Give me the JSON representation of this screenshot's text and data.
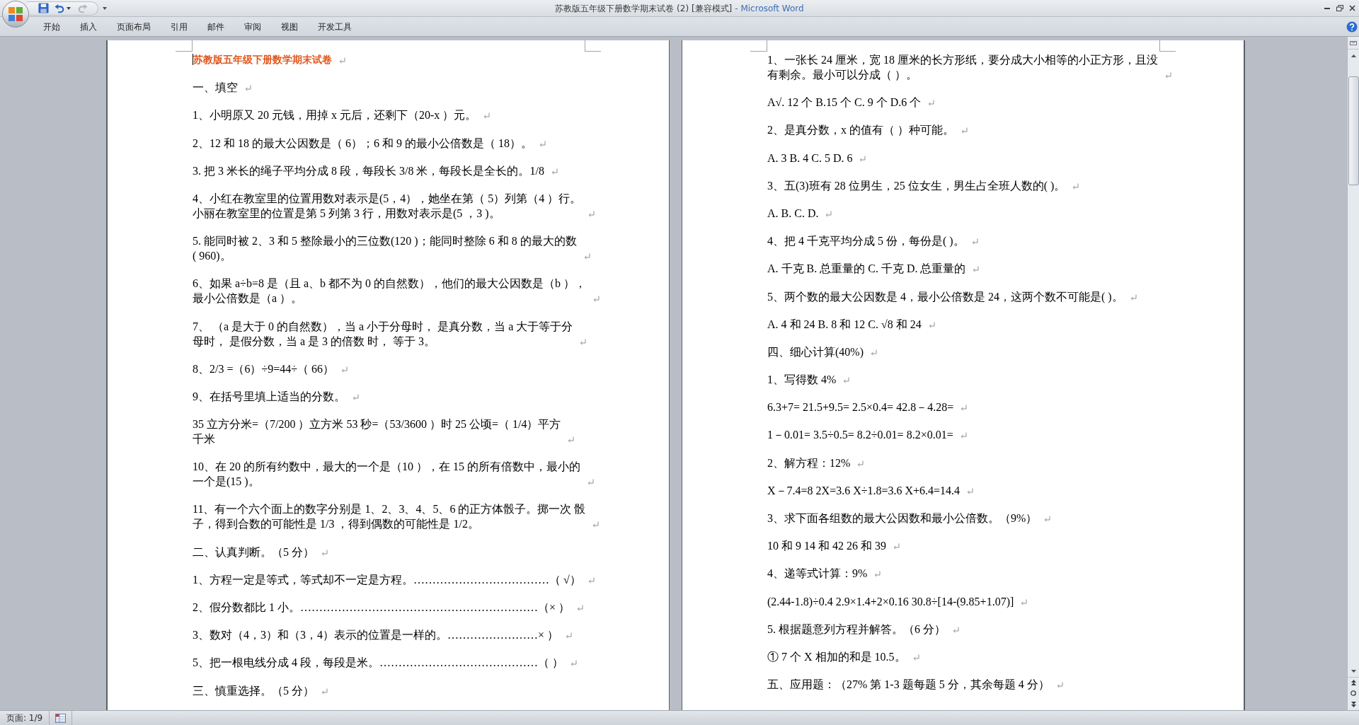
{
  "title_bar": {
    "document": "苏教版五年级下册数学期末试卷 (2) [兼容模式]",
    "app": "- Microsoft Word"
  },
  "quick_access": [
    {
      "kind": "save",
      "disabled": false
    },
    {
      "kind": "undo",
      "disabled": false
    },
    {
      "kind": "redo",
      "disabled": true
    }
  ],
  "ribbon_tabs": [
    {
      "label": "开始",
      "selected": false
    },
    {
      "label": "插入",
      "selected": false
    },
    {
      "label": "页面布局",
      "selected": false
    },
    {
      "label": "引用",
      "selected": false
    },
    {
      "label": "邮件",
      "selected": false
    },
    {
      "label": "审阅",
      "selected": false
    },
    {
      "label": "视图",
      "selected": false
    },
    {
      "label": "开发工具",
      "selected": false
    }
  ],
  "pages": [
    {
      "caret_at_start": true,
      "paragraphs": [
        {
          "kind": "title",
          "lines": [
            "苏教版五年级下册数学期末试卷"
          ]
        },
        {
          "kind": "text",
          "lines": [
            "一、填空"
          ]
        },
        {
          "kind": "text",
          "lines": [
            "1、小明原又 20 元钱，用掉 x 元后，还剩下（20-x ）元。"
          ]
        },
        {
          "kind": "text",
          "lines": [
            "2、12 和 18 的最大公因数是（ 6）；6 和 9 的最小公倍数是（ 18）。"
          ]
        },
        {
          "kind": "text",
          "lines": [
            "3. 把 3 米长的绳子平均分成 8 段，每段长 3/8 米，每段长是全长的。1/8"
          ]
        },
        {
          "kind": "text",
          "lines": [
            "4、小红在教室里的位置用数对表示是(5，4），她坐在第（ 5）列第（4 ）行。",
            "小丽在教室里的位置是第 5 列第 3 行，用数对表示是(5 ，3 )。"
          ]
        },
        {
          "kind": "text",
          "lines": [
            "5. 能同时被 2、3 和 5 整除最小的三位数(120 )；能同时整除 6 和 8 的最大的数",
            "( 960)。"
          ]
        },
        {
          "kind": "text",
          "lines": [
            "6、如果 a÷b=8 是（且 a、b 都不为 0 的自然数），他们的最大公因数是（b ），",
            "最小公倍数是（a ）。"
          ]
        },
        {
          "kind": "text",
          "lines": [
            "7、 （a 是大于 0 的自然数），当 a 小于分母时， 是真分数，当 a 大于等于分",
            "母时， 是假分数，当 a 是 3 的倍数 时， 等于 3。"
          ]
        },
        {
          "kind": "text",
          "lines": [
            "8、2/3 =（6）÷9=44÷（ 66）"
          ]
        },
        {
          "kind": "text",
          "lines": [
            "9、在括号里填上适当的分数。"
          ]
        },
        {
          "kind": "text",
          "lines": [
            "35 立方分米=（7/200 ）立方米 53 秒=（53/3600 ）时 25 公顷=（ 1/4）平方",
            "千米"
          ]
        },
        {
          "kind": "text",
          "lines": [
            "10、在 20 的所有约数中，最大的一个是（10 ），在 15 的所有倍数中，最小的",
            "一个是(15 )。"
          ]
        },
        {
          "kind": "text",
          "lines": [
            "11、有一个六个面上的数字分别是 1、2、3、4、5、6 的正方体骰子。掷一次 骰",
            "子，得到合数的可能性是 1/3 ，得到偶数的可能性是 1/2。"
          ]
        },
        {
          "kind": "text",
          "lines": [
            "二、认真判断。（5 分）"
          ]
        },
        {
          "kind": "text",
          "lines": [
            "1、方程一定是等式，等式却不一定是方程。………………………………（ √）"
          ]
        },
        {
          "kind": "text",
          "lines": [
            "2、假分数都比 1 小。………………………………………………………（× ）"
          ]
        },
        {
          "kind": "text",
          "lines": [
            "3、数对（4，3）和（3，4）表示的位置是一样的。……………………× ）"
          ]
        },
        {
          "kind": "text",
          "lines": [
            "5、把一根电线分成 4 段，每段是米。……………………………………（ ）"
          ]
        },
        {
          "kind": "text",
          "lines": [
            "三、慎重选择。（5 分）"
          ]
        }
      ]
    },
    {
      "caret_at_start": false,
      "paragraphs": [
        {
          "kind": "text",
          "lines": [
            "1、一张长 24 厘米，宽 18 厘米的长方形纸，要分成大小相等的小正方形，且没",
            "有剩余。最小可以分成（ ）。"
          ]
        },
        {
          "kind": "text",
          "lines": [
            "A√. 12 个 B.15 个 C. 9 个 D.6 个"
          ]
        },
        {
          "kind": "text",
          "lines": [
            "2、是真分数，x 的值有（ ）种可能。"
          ]
        },
        {
          "kind": "text",
          "lines": [
            "A. 3 B. 4 C. 5 D. 6"
          ]
        },
        {
          "kind": "text",
          "lines": [
            "3、五(3)班有 28 位男生，25 位女生，男生占全班人数的( )。"
          ]
        },
        {
          "kind": "text",
          "lines": [
            "A. B. C. D."
          ]
        },
        {
          "kind": "text",
          "lines": [
            "4、把 4 千克平均分成 5 份，每份是( )。"
          ]
        },
        {
          "kind": "text",
          "lines": [
            "A. 千克 B. 总重量的 C. 千克 D. 总重量的"
          ]
        },
        {
          "kind": "text",
          "lines": [
            "5、两个数的最大公因数是 4，最小公倍数是 24，这两个数不可能是( )。"
          ]
        },
        {
          "kind": "text",
          "lines": [
            "A. 4 和 24 B. 8 和 12 C. √8 和 24"
          ]
        },
        {
          "kind": "text",
          "lines": [
            "四、细心计算(40%)"
          ]
        },
        {
          "kind": "text",
          "lines": [
            "1、写得数 4%"
          ]
        },
        {
          "kind": "text",
          "lines": [
            "6.3+7= 21.5+9.5= 2.5×0.4= 42.8－4.28="
          ]
        },
        {
          "kind": "text",
          "lines": [
            "1－0.01= 3.5÷0.5= 8.2÷0.01= 8.2×0.01="
          ]
        },
        {
          "kind": "text",
          "lines": [
            "2、解方程：12%"
          ]
        },
        {
          "kind": "text",
          "lines": [
            "X－7.4=8 2X=3.6 X÷1.8=3.6 X+6.4=14.4"
          ]
        },
        {
          "kind": "text",
          "lines": [
            "3、求下面各组数的最大公因数和最小公倍数。（9%）"
          ]
        },
        {
          "kind": "text",
          "lines": [
            "10 和 9 14 和 42 26 和 39"
          ]
        },
        {
          "kind": "text",
          "lines": [
            "4、递等式计算：9%"
          ]
        },
        {
          "kind": "text",
          "lines": [
            "(2.44-1.8)÷0.4 2.9×1.4+2×0.16 30.8÷[14-(9.85+1.07)]"
          ]
        },
        {
          "kind": "text",
          "lines": [
            "5. 根据题意列方程并解答。（6 分）"
          ]
        },
        {
          "kind": "text",
          "lines": [
            "① 7 个 X 相加的和是 10.5。"
          ]
        },
        {
          "kind": "text",
          "lines": [
            "五、应用题：（27% 第 1-3 题每题 5 分，其余每题 4 分）"
          ]
        }
      ]
    }
  ],
  "status_bar": {
    "page": "页面: 1/9"
  }
}
